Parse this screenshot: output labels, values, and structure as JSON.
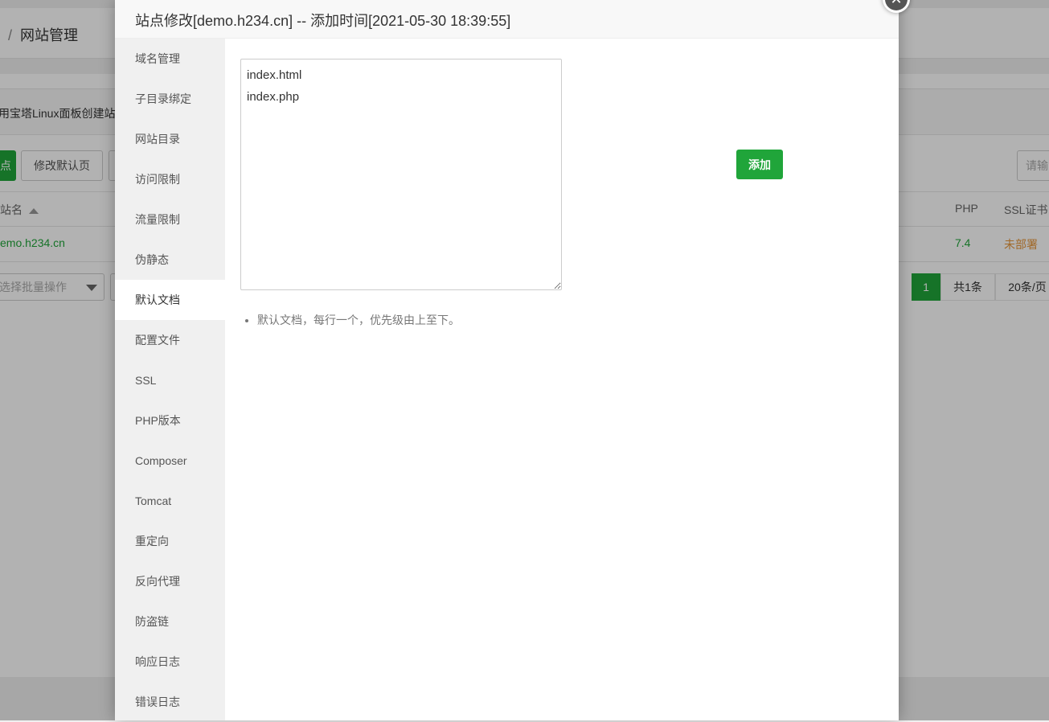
{
  "background": {
    "breadcrumb_sep": "/",
    "breadcrumb": "网站管理",
    "notice": "用宝塔Linux面板创建站",
    "btn_add_site": "点",
    "btn_default_page": "修改默认页",
    "search_placeholder": "请输",
    "table_headers": {
      "site": "站名",
      "php": "PHP",
      "ssl": "SSL证书"
    },
    "row": {
      "site": "emo.h234.cn",
      "php": "7.4",
      "ssl": "未部署"
    },
    "batch_select": "选择批量操作",
    "pagination": {
      "current": "1",
      "total": "共1条",
      "per_page": "20条/页"
    }
  },
  "modal": {
    "title": "站点修改[demo.h234.cn] -- 添加时间[2021-05-30 18:39:55]",
    "close_glyph": "✕",
    "sidebar": [
      "域名管理",
      "子目录绑定",
      "网站目录",
      "访问限制",
      "流量限制",
      "伪静态",
      "默认文档",
      "配置文件",
      "SSL",
      "PHP版本",
      "Composer",
      "Tomcat",
      "重定向",
      "反向代理",
      "防盗链",
      "响应日志",
      "错误日志"
    ],
    "active_index": 6,
    "default_docs_value": "index.html\nindex.php",
    "add_button": "添加",
    "tip": "默认文档，每行一个，优先级由上至下。"
  },
  "colors": {
    "accent_green": "#20a53a",
    "warning_orange": "#e5953a"
  }
}
